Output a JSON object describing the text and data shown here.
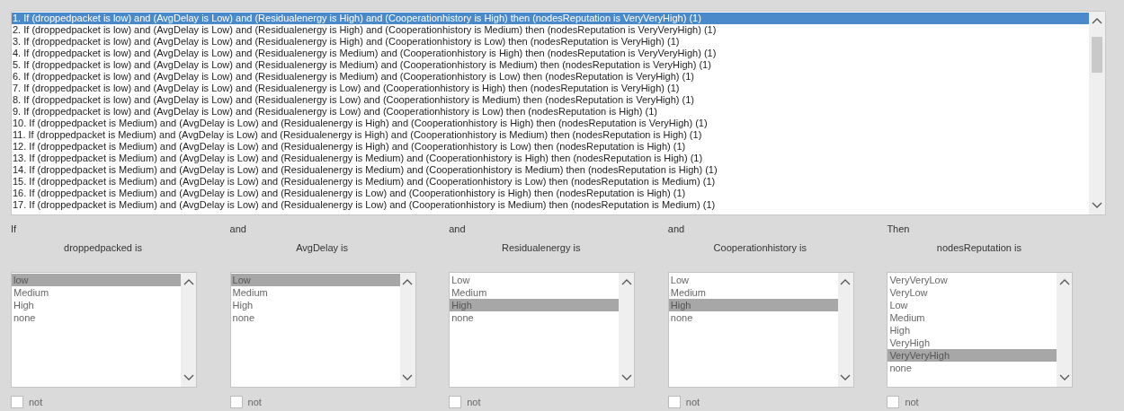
{
  "rules": [
    {
      "text": "1. If (droppedpacket is low) and (AvgDelay is Low) and (Residualenergy is High) and (Cooperationhistory is High) then (nodesReputation is VeryVeryHigh) (1)",
      "selected": true
    },
    {
      "text": "2. If (droppedpacket is low) and (AvgDelay is Low) and (Residualenergy is High) and (Cooperationhistory is Medium) then (nodesReputation is VeryVeryHigh) (1)",
      "selected": false
    },
    {
      "text": "3. If (droppedpacket is low) and (AvgDelay is Low) and (Residualenergy is High) and (Cooperationhistory is Low) then (nodesReputation is VeryHigh) (1)",
      "selected": false
    },
    {
      "text": "4. If (droppedpacket is low) and (AvgDelay is Low) and (Residualenergy is Medium) and (Cooperationhistory is High) then (nodesReputation is VeryVeryHigh) (1)",
      "selected": false
    },
    {
      "text": "5. If (droppedpacket is low) and (AvgDelay is Low) and (Residualenergy is Medium) and (Cooperationhistory is Medium) then (nodesReputation is VeryHigh) (1)",
      "selected": false
    },
    {
      "text": "6. If (droppedpacket is low) and (AvgDelay is Low) and (Residualenergy is Medium) and (Cooperationhistory is Low) then (nodesReputation is VeryHigh) (1)",
      "selected": false
    },
    {
      "text": "7. If (droppedpacket is low) and (AvgDelay is Low) and (Residualenergy is Low) and (Cooperationhistory is High) then (nodesReputation is VeryHigh) (1)",
      "selected": false
    },
    {
      "text": "8. If (droppedpacket is low) and (AvgDelay is Low) and (Residualenergy is Low) and (Cooperationhistory is Medium) then (nodesReputation is VeryHigh) (1)",
      "selected": false
    },
    {
      "text": "9. If (droppedpacket is low) and (AvgDelay is Low) and (Residualenergy is Low) and (Cooperationhistory is Low) then (nodesReputation is High) (1)",
      "selected": false
    },
    {
      "text": "10. If (droppedpacket is Medium) and (AvgDelay is Low) and (Residualenergy is High) and (Cooperationhistory is High) then (nodesReputation is VeryHigh) (1)",
      "selected": false
    },
    {
      "text": "11. If (droppedpacket is Medium) and (AvgDelay is Low) and (Residualenergy is High) and (Cooperationhistory is Medium) then (nodesReputation is High) (1)",
      "selected": false
    },
    {
      "text": "12. If (droppedpacket is Medium) and (AvgDelay is Low) and (Residualenergy is High) and (Cooperationhistory is Low) then (nodesReputation is High) (1)",
      "selected": false
    },
    {
      "text": "13. If (droppedpacket is Medium) and (AvgDelay is Low) and (Residualenergy is Medium) and (Cooperationhistory is High) then (nodesReputation is High) (1)",
      "selected": false
    },
    {
      "text": "14. If (droppedpacket is Medium) and (AvgDelay is Low) and (Residualenergy is Medium) and (Cooperationhistory is Medium) then (nodesReputation is High) (1)",
      "selected": false
    },
    {
      "text": "15. If (droppedpacket is Medium) and (AvgDelay is Low) and (Residualenergy is Medium) and (Cooperationhistory is Low) then (nodesReputation is Medium) (1)",
      "selected": false
    },
    {
      "text": "16. If (droppedpacket is Medium) and (AvgDelay is Low) and (Residualenergy is Low) and (Cooperationhistory is High) then (nodesReputation is High) (1)",
      "selected": false
    },
    {
      "text": "17. If (droppedpacket is Medium) and (AvgDelay is Low) and (Residualenergy is Low) and (Cooperationhistory is Medium) then (nodesReputation is Medium) (1)",
      "selected": false
    }
  ],
  "variables": [
    {
      "connector": "If",
      "label": "droppedpacked is",
      "not_label": "not",
      "not_checked": false,
      "options": [
        {
          "text": "low",
          "selected": true
        },
        {
          "text": "Medium",
          "selected": false
        },
        {
          "text": "High",
          "selected": false
        },
        {
          "text": "none",
          "selected": false
        }
      ]
    },
    {
      "connector": "and",
      "label": "AvgDelay is",
      "not_label": "not",
      "not_checked": false,
      "options": [
        {
          "text": "Low",
          "selected": true
        },
        {
          "text": "Medium",
          "selected": false
        },
        {
          "text": "High",
          "selected": false
        },
        {
          "text": "none",
          "selected": false
        }
      ]
    },
    {
      "connector": "and",
      "label": "Residualenergy is",
      "not_label": "not",
      "not_checked": false,
      "options": [
        {
          "text": "Low",
          "selected": false
        },
        {
          "text": "Medium",
          "selected": false
        },
        {
          "text": "High",
          "selected": true
        },
        {
          "text": "none",
          "selected": false
        }
      ]
    },
    {
      "connector": "and",
      "label": "Cooperationhistory is",
      "not_label": "not",
      "not_checked": false,
      "options": [
        {
          "text": "Low",
          "selected": false
        },
        {
          "text": "Medium",
          "selected": false
        },
        {
          "text": "High",
          "selected": true
        },
        {
          "text": "none",
          "selected": false
        }
      ]
    },
    {
      "connector": "Then",
      "label": "nodesReputation is",
      "not_label": "not",
      "not_checked": false,
      "options": [
        {
          "text": "VeryVeryLow",
          "selected": false
        },
        {
          "text": "VeryLow",
          "selected": false
        },
        {
          "text": "Low",
          "selected": false
        },
        {
          "text": "Medium",
          "selected": false
        },
        {
          "text": "High",
          "selected": false
        },
        {
          "text": "VeryHigh",
          "selected": false
        },
        {
          "text": "VeryVeryHigh",
          "selected": true
        },
        {
          "text": "none",
          "selected": false
        }
      ]
    }
  ]
}
